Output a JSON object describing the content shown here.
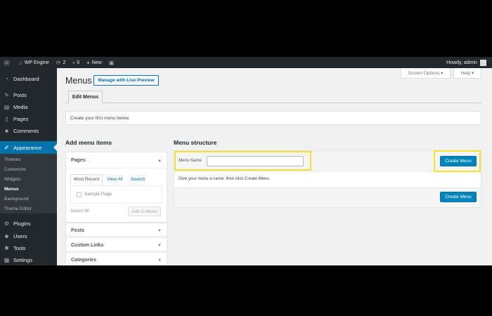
{
  "admin_bar": {
    "site_name": "WP Engine",
    "updates_count": "2",
    "comments_count": "0",
    "new_label": "New",
    "greeting": "Howdy, admin"
  },
  "sidebar": {
    "items": [
      {
        "label": "Dashboard",
        "icon": "dashboard-icon"
      },
      {
        "label": "Posts",
        "icon": "pin-icon"
      },
      {
        "label": "Media",
        "icon": "media-icon"
      },
      {
        "label": "Pages",
        "icon": "page-icon"
      },
      {
        "label": "Comments",
        "icon": "comment-icon"
      },
      {
        "label": "Appearance",
        "icon": "brush-icon"
      },
      {
        "label": "Plugins",
        "icon": "plugin-icon"
      },
      {
        "label": "Users",
        "icon": "users-icon"
      },
      {
        "label": "Tools",
        "icon": "wrench-icon"
      },
      {
        "label": "Settings",
        "icon": "settings-icon"
      }
    ],
    "submenu": [
      "Themes",
      "Customize",
      "Widgets",
      "Menus",
      "Background",
      "Theme Editor"
    ]
  },
  "header": {
    "title": "Menus",
    "live_preview_label": "Manage with Live Preview",
    "screen_options_label": "Screen Options ▾",
    "help_label": "Help ▾"
  },
  "tabs": {
    "edit_menus": "Edit Menus"
  },
  "notice": "Create your first menu below.",
  "add_items": {
    "heading": "Add menu items",
    "pages_title": "Pages",
    "inner_tabs": [
      "Most Recent",
      "View All",
      "Search"
    ],
    "sample_page": "Sample Page",
    "select_all": "Select All",
    "add_to_menu": "Add to Menu",
    "other_sections": [
      "Posts",
      "Custom Links",
      "Categories"
    ]
  },
  "structure": {
    "heading": "Menu structure",
    "menu_name_label": "Menu Name",
    "menu_name_value": "",
    "hint": "Give your menu a name, then click Create Menu.",
    "create_label": "Create Menu"
  },
  "colors": {
    "accent": "#0073aa",
    "highlight": "#f7e12a",
    "admin_bar": "#23282d"
  }
}
